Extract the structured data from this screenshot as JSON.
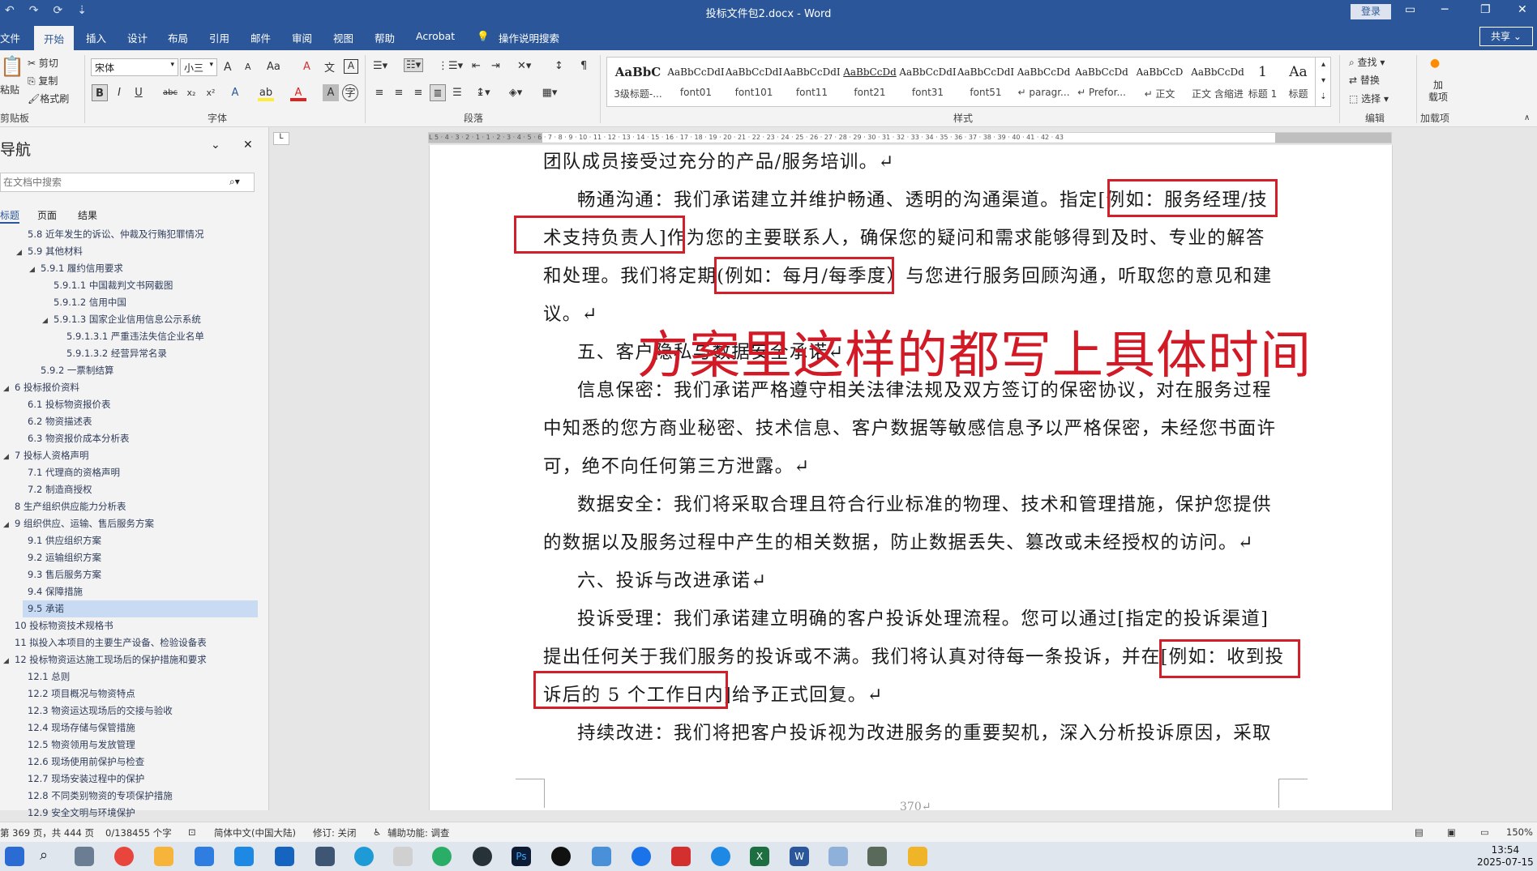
{
  "titlebar": {
    "title": "投标文件包2.docx  -  Word",
    "login": "登录",
    "qat_save": "↶",
    "qat_undo": "↷",
    "qat_refresh": "⟳",
    "qat_more": "⇣"
  },
  "tabs": [
    "文件",
    "开始",
    "插入",
    "设计",
    "布局",
    "引用",
    "邮件",
    "审阅",
    "视图",
    "帮助",
    "Acrobat",
    "操作说明搜索"
  ],
  "share": "共享",
  "ribbon": {
    "clipboard": {
      "paste": "粘贴",
      "cut": "剪切",
      "copy": "复制",
      "format_painter": "格式刷",
      "label": "剪贴板"
    },
    "font": {
      "name": "宋体",
      "size": "小三",
      "label": "字体",
      "grow": "A",
      "shrink": "A",
      "case": "Aa",
      "clear": "A",
      "bold": "B",
      "italic": "I",
      "underline": "U",
      "strike": "abc",
      "sub": "x₂",
      "sup": "x²"
    },
    "paragraph": {
      "label": "段落"
    },
    "styles": {
      "label": "样式",
      "items": [
        {
          "preview": "AaBbC",
          "name": "3级标题-..."
        },
        {
          "preview": "AaBbCcDdI",
          "name": "font01"
        },
        {
          "preview": "AaBbCcDdI",
          "name": "font101"
        },
        {
          "preview": "AaBbCcDdI",
          "name": "font11"
        },
        {
          "preview": "AaBbCcDd",
          "name": "font21"
        },
        {
          "preview": "AaBbCcDdI",
          "name": "font31"
        },
        {
          "preview": "AaBbCcDdI",
          "name": "font51"
        },
        {
          "preview": "AaBbCcDd",
          "name": "↵ paragr..."
        },
        {
          "preview": "AaBbCcDd",
          "name": "↵ Prefor..."
        },
        {
          "preview": "AaBbCcD",
          "name": "↵ 正文"
        },
        {
          "preview": "AaBbCcDd",
          "name": "正文 含缩进"
        },
        {
          "preview": "1",
          "name": "标题 1"
        },
        {
          "preview": "Aa",
          "name": "标题"
        }
      ]
    },
    "editing": {
      "find": "查找",
      "replace": "替换",
      "select": "选择",
      "label": "编辑"
    },
    "addins": {
      "add": "加载项",
      "label": "加载项",
      "add_short": "加\n载项"
    }
  },
  "nav": {
    "title": "导航",
    "search_placeholder": "在文档中搜索",
    "tabs": [
      "标题",
      "页面",
      "结果"
    ],
    "items": [
      {
        "text": "5.8 近年发生的诉讼、仲裁及行贿犯罪情况",
        "indent": 2,
        "tw": ""
      },
      {
        "text": "5.9 其他材料",
        "indent": 2,
        "tw": "◢"
      },
      {
        "text": "5.9.1 履约信用要求",
        "indent": 3,
        "tw": "◢"
      },
      {
        "text": "5.9.1.1 中国裁判文书网截图",
        "indent": 4,
        "tw": ""
      },
      {
        "text": "5.9.1.2 信用中国",
        "indent": 4,
        "tw": ""
      },
      {
        "text": "5.9.1.3 国家企业信用信息公示系统",
        "indent": 4,
        "tw": "◢"
      },
      {
        "text": "5.9.1.3.1 严重违法失信企业名单",
        "indent": 5,
        "tw": ""
      },
      {
        "text": "5.9.1.3.2 经营异常名录",
        "indent": 5,
        "tw": ""
      },
      {
        "text": "5.9.2 一票制结算",
        "indent": 3,
        "tw": ""
      },
      {
        "text": "6 投标报价资料",
        "indent": 1,
        "tw": "◢"
      },
      {
        "text": "6.1 投标物资报价表",
        "indent": 2,
        "tw": ""
      },
      {
        "text": "6.2 物资描述表",
        "indent": 2,
        "tw": ""
      },
      {
        "text": "6.3 物资报价成本分析表",
        "indent": 2,
        "tw": ""
      },
      {
        "text": "7 投标人资格声明",
        "indent": 1,
        "tw": "◢"
      },
      {
        "text": "7.1 代理商的资格声明",
        "indent": 2,
        "tw": ""
      },
      {
        "text": "7.2 制造商授权",
        "indent": 2,
        "tw": ""
      },
      {
        "text": "8 生产组织供应能力分析表",
        "indent": 1,
        "tw": ""
      },
      {
        "text": "9 组织供应、运输、售后服务方案",
        "indent": 1,
        "tw": "◢"
      },
      {
        "text": "9.1 供应组织方案",
        "indent": 2,
        "tw": ""
      },
      {
        "text": "9.2 运输组织方案",
        "indent": 2,
        "tw": ""
      },
      {
        "text": "9.3 售后服务方案",
        "indent": 2,
        "tw": ""
      },
      {
        "text": "9.4 保障措施",
        "indent": 2,
        "tw": ""
      },
      {
        "text": "9.5 承诺",
        "indent": 2,
        "tw": "",
        "selected": true
      },
      {
        "text": "10 投标物资技术规格书",
        "indent": 1,
        "tw": ""
      },
      {
        "text": "11 拟投入本项目的主要生产设备、检验设备表",
        "indent": 1,
        "tw": ""
      },
      {
        "text": "12 投标物资运达施工现场后的保护措施和要求",
        "indent": 1,
        "tw": "◢"
      },
      {
        "text": "12.1 总则",
        "indent": 2,
        "tw": ""
      },
      {
        "text": "12.2 项目概况与物资特点",
        "indent": 2,
        "tw": ""
      },
      {
        "text": "12.3 物资运达现场后的交接与验收",
        "indent": 2,
        "tw": ""
      },
      {
        "text": "12.4 现场存储与保管措施",
        "indent": 2,
        "tw": ""
      },
      {
        "text": "12.5 物资领用与发放管理",
        "indent": 2,
        "tw": ""
      },
      {
        "text": "12.6 现场使用前保护与检查",
        "indent": 2,
        "tw": ""
      },
      {
        "text": "12.7 现场安装过程中的保护",
        "indent": 2,
        "tw": ""
      },
      {
        "text": "12.8 不同类别物资的专项保护措施",
        "indent": 2,
        "tw": ""
      },
      {
        "text": "12.9 安全文明与环境保护",
        "indent": 2,
        "tw": ""
      }
    ]
  },
  "ruler": "L 5 · 4 · 3 · 2 · 1 · 1 · 2 · 3 · 4 · 5 · 6 · 7 · 8 · 9 · 10 · 11 · 12 · 13 · 14 · 15 · 16 · 17 · 18 · 19 · 20 · 21 · 22 · 23 · 24 · 25 · 26 · 27 · 28 · 29 · 30 · 31 · 32 · 33 · 34 · 35 · 36 · 37 · 38 · 39 · 40 · 41 · 42 · 43",
  "document": {
    "lines": [
      {
        "text": "团队成员接受过充分的产品/服务培训。↵",
        "indent": 0
      },
      {
        "text": "畅通沟通：我们承诺建立并维护畅通、透明的沟通渠道。指定[例如：服务经理/技",
        "indent": 1
      },
      {
        "text": "术支持负责人]作为您的主要联系人，确保您的疑问和需求能够得到及时、专业的解答",
        "indent": 0
      },
      {
        "text": "和处理。我们将定期(例如：每月/每季度）与您进行服务回顾沟通，听取您的意见和建",
        "indent": 0
      },
      {
        "text": "议。↵",
        "indent": 0
      },
      {
        "text": "五、客户隐私与数据安全承诺↵",
        "indent": 1
      },
      {
        "text": "信息保密：我们承诺严格遵守相关法律法规及双方签订的保密协议，对在服务过程",
        "indent": 1
      },
      {
        "text": "中知悉的您方商业秘密、技术信息、客户数据等敏感信息予以严格保密，未经您书面许",
        "indent": 0
      },
      {
        "text": "可，绝不向任何第三方泄露。↵",
        "indent": 0
      },
      {
        "text": "数据安全：我们将采取合理且符合行业标准的物理、技术和管理措施，保护您提供",
        "indent": 1
      },
      {
        "text": "的数据以及服务过程中产生的相关数据，防止数据丢失、篡改或未经授权的访问。↵",
        "indent": 0
      },
      {
        "text": "六、投诉与改进承诺↵",
        "indent": 1
      },
      {
        "text": "投诉受理：我们承诺建立明确的客户投诉处理流程。您可以通过[指定的投诉渠道]",
        "indent": 1
      },
      {
        "text": "提出任何关于我们服务的投诉或不满。我们将认真对待每一条投诉，并在[例如：收到投",
        "indent": 0
      },
      {
        "text": "诉后的 5 个工作日内]给予正式回复。↵",
        "indent": 0
      },
      {
        "text": "持续改进：我们将把客户投诉视为改进服务的重要契机，深入分析投诉原因，采取",
        "indent": 1
      }
    ],
    "overlay_note": "方案里这样的都写上具体时间",
    "page_number": "370↵"
  },
  "status": {
    "page": "第 369 页，共 444 页",
    "words": "0/138455 个字",
    "lang": "简体中文(中国大陆)",
    "track": "修订: 关闭",
    "access": "辅助功能: 调查",
    "zoom": "150%"
  },
  "taskbar": {
    "time": "13:54",
    "date": "2025-07-15"
  },
  "colors": {
    "brand": "#2b579a",
    "annotation_red": "#d21f2a"
  }
}
